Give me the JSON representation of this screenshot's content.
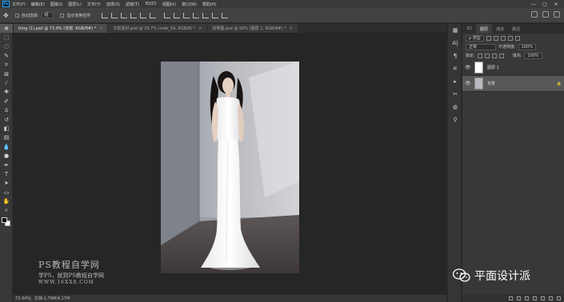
{
  "app": {
    "logo": "Ps",
    "window_buttons": [
      "—",
      "□",
      "✕"
    ]
  },
  "menu": [
    "文件(F)",
    "编辑(E)",
    "图像(I)",
    "图层(L)",
    "文字(Y)",
    "选择(S)",
    "滤镜(T)",
    "3D(D)",
    "视图(V)",
    "窗口(W)",
    "帮助(H)"
  ],
  "options": {
    "auto_select_label": "自动选择:",
    "auto_select_value": "组",
    "transform_label": "显示变换控件"
  },
  "tabs": [
    {
      "label": "timg (1).psd @ 73.9% (背景, RGB/8#) *",
      "close": "×"
    },
    {
      "label": "华前素材.psd @ 25.7% (mile_54, RGB/8) *",
      "close": "×"
    },
    {
      "label": "效果图.psd @ 50% (图层 1, RGB/8#) *",
      "close": "×"
    }
  ],
  "status": {
    "zoom": "73.94%",
    "doc": "文档:1.79M/4.17M"
  },
  "panel": {
    "tabs": [
      "3D",
      "图层",
      "通道",
      "路径"
    ],
    "filter_kind": "ρ 类型",
    "blend_mode": "正常",
    "opacity_label": "不透明度:",
    "opacity_value": "100%",
    "lock_label": "锁定:",
    "fill_label": "填充:",
    "fill_value": "100%",
    "layers": [
      {
        "name": "图层 1",
        "visible": "👁"
      },
      {
        "name": "背景",
        "visible": "👁",
        "lock": "🔒"
      }
    ]
  },
  "watermarks": {
    "left_line1": "PS教程自学网",
    "left_line2": "学PS，就到PS教程自学网",
    "left_line3": "WWW.16XX8.COM",
    "right_text": "平面设计派"
  },
  "colors": {
    "fg": "#000000",
    "bg": "#ffffff",
    "accent": "#31a8ff"
  }
}
